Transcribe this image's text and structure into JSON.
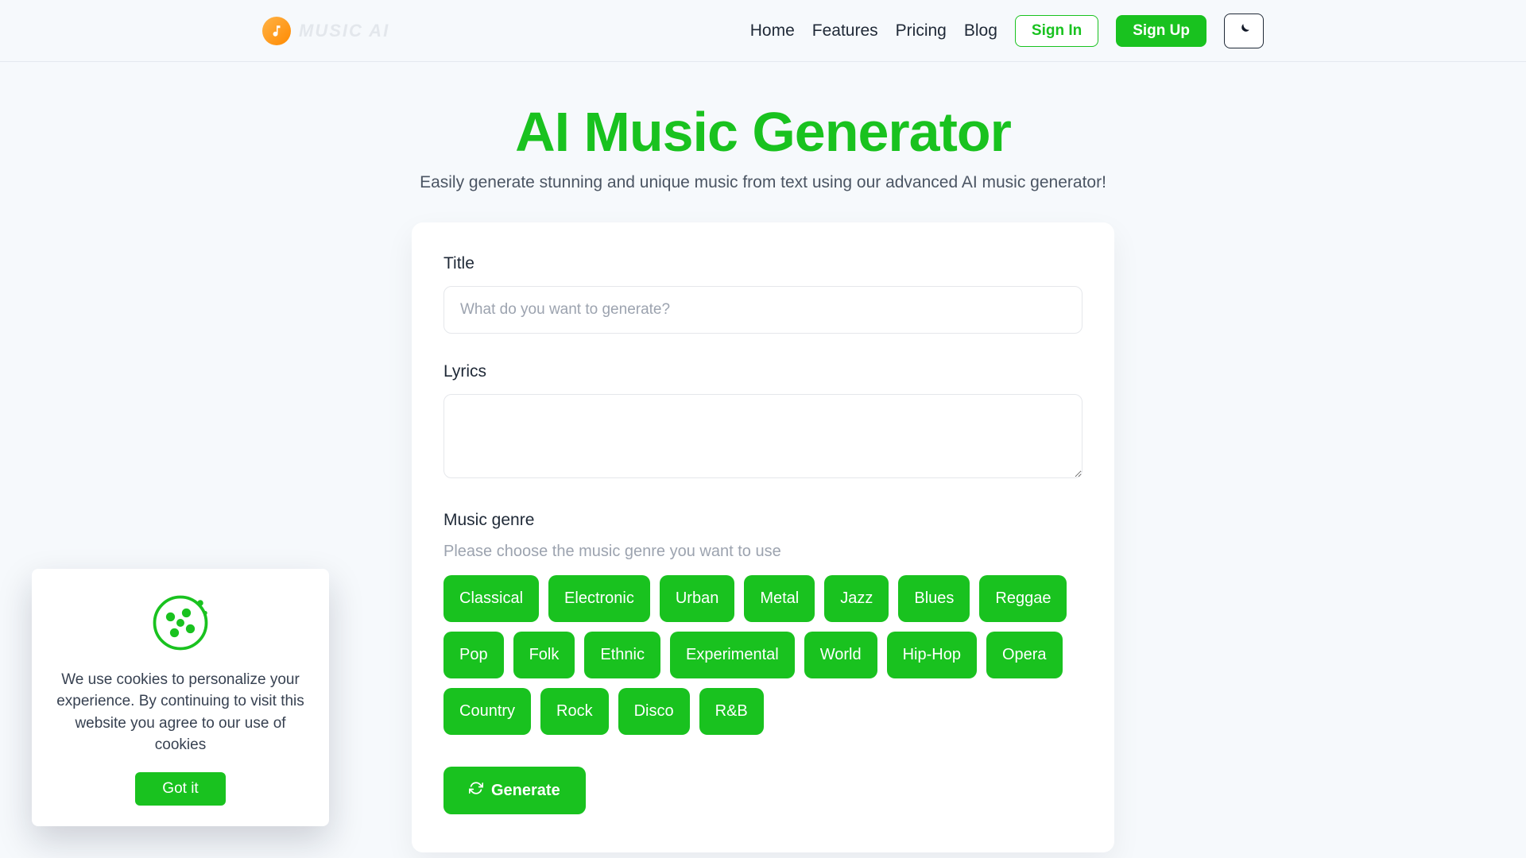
{
  "brand": {
    "name": "MUSIC AI"
  },
  "nav": {
    "links": [
      "Home",
      "Features",
      "Pricing",
      "Blog"
    ],
    "sign_in": "Sign In",
    "sign_up": "Sign Up"
  },
  "hero": {
    "title": "AI Music Generator",
    "subtitle": "Easily generate stunning and unique music from text using our advanced AI music generator!"
  },
  "form": {
    "title_label": "Title",
    "title_placeholder": "What do you want to generate?",
    "title_value": "",
    "lyrics_label": "Lyrics",
    "lyrics_value": "",
    "genre_label": "Music genre",
    "genre_hint": "Please choose the music genre you want to use",
    "genres": [
      "Classical",
      "Electronic",
      "Urban",
      "Metal",
      "Jazz",
      "Blues",
      "Reggae",
      "Pop",
      "Folk",
      "Ethnic",
      "Experimental",
      "World",
      "Hip-Hop",
      "Opera",
      "Country",
      "Rock",
      "Disco",
      "R&B"
    ],
    "generate_label": "Generate"
  },
  "cookie": {
    "text": "We use cookies to personalize your experience. By continuing to visit this website you agree to our use of cookies",
    "button": "Got it"
  },
  "colors": {
    "accent": "#19c21f"
  }
}
